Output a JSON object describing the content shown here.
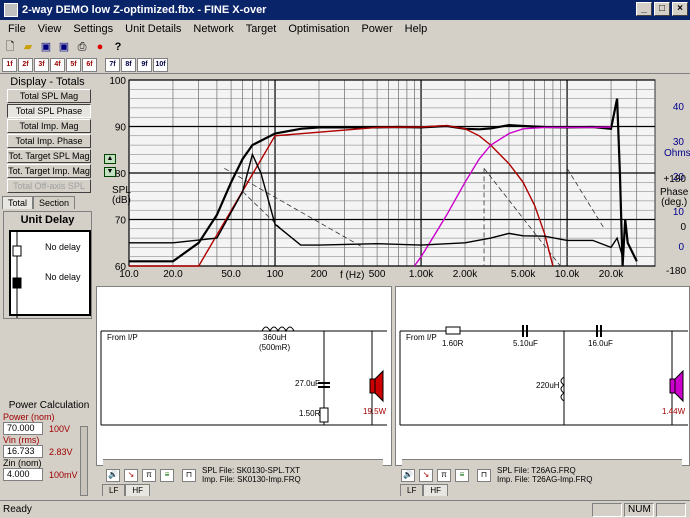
{
  "window": {
    "title": "2-way DEMO low Z-optimized.fbx - FINE X-over"
  },
  "menu": [
    "File",
    "View",
    "Settings",
    "Unit Details",
    "Network",
    "Target",
    "Optimisation",
    "Power",
    "Help"
  ],
  "toolbar2": [
    "1f",
    "2f",
    "3f",
    "4f",
    "5f",
    "6f",
    "7f",
    "8f",
    "9f",
    "10f"
  ],
  "display": {
    "title": "Display - Totals",
    "buttons": [
      "Total SPL Mag",
      "Total SPL Phase",
      "Total Imp. Mag",
      "Total Imp. Phase",
      "Tot. Target SPL Mag",
      "Tot. Target Imp. Mag",
      "Total Off-axis SPL"
    ],
    "tab_total": "Total",
    "tab_section": "Section"
  },
  "unit_delay": {
    "title": "Unit Delay",
    "delay1": "No delay",
    "delay2": "No delay"
  },
  "power": {
    "title": "Power Calculation",
    "power_label": "Power (nom)",
    "power_value": "70.000",
    "power_volt": "100V",
    "vin_label": "Vin (rms)",
    "vin_value": "16.733",
    "vin_volt": "2.83V",
    "zin_label": "Zin (nom)",
    "zin_value": "4.000",
    "zin_volt": "100mV"
  },
  "chart_data": {
    "type": "line",
    "xscale": "log",
    "xlim": [
      10,
      40000
    ],
    "ylim_left": [
      60,
      100
    ],
    "y_ticks_left": [
      "100",
      "90",
      "80",
      "70",
      "60"
    ],
    "ylabel": "SPL\n(dB)",
    "xlabel": "f (Hz)",
    "x_tick_labels": [
      "10.0",
      "20.0",
      "50.0",
      "100",
      "200",
      "500",
      "1.00k",
      "2.00k",
      "5.00k",
      "10.0k",
      "20.0k"
    ],
    "x_tick_values": [
      10,
      20,
      50,
      100,
      200,
      500,
      1000,
      2000,
      5000,
      10000,
      20000
    ],
    "right_axis": {
      "ohms_label": "Ohms",
      "ohms_ticks": [
        "40",
        "30",
        "20",
        "10",
        "0"
      ],
      "phase_label": "Phase\n(deg.)",
      "phase_ticks": [
        "+180",
        "0",
        "-180"
      ]
    },
    "series": [
      {
        "color": "#000000",
        "values_x": [
          10,
          20,
          30,
          40,
          50,
          60,
          70,
          100,
          150,
          200,
          300,
          500,
          700,
          1000,
          1500,
          2000,
          2500,
          3000,
          4000,
          5000,
          7000,
          10000,
          15000,
          20000,
          22000,
          23000,
          24000,
          25000,
          26000,
          30000
        ],
        "values_y": [
          61,
          61,
          65,
          71,
          78,
          83,
          86,
          88.5,
          89.5,
          89.8,
          89.8,
          89.8,
          89.9,
          89.8,
          90.1,
          89.5,
          89.4,
          89.6,
          90.3,
          90.1,
          89.9,
          89.8,
          89.9,
          89.5,
          96,
          80,
          60,
          70,
          65,
          61
        ]
      },
      {
        "color": "#b00000",
        "values_x": [
          10,
          30,
          100,
          500,
          1000,
          1500,
          2000,
          2500,
          3000,
          4000,
          5000,
          6000,
          7000,
          8000
        ],
        "values_y": [
          55,
          58,
          88,
          89.8,
          89.9,
          90.2,
          89.5,
          88,
          86,
          82,
          78,
          73,
          67,
          60
        ]
      },
      {
        "color": "#cc00cc",
        "values_x": [
          900,
          1000,
          1200,
          1500,
          2000,
          2500,
          3000,
          4000,
          5000,
          7000,
          10000,
          15000,
          20000
        ],
        "values_y": [
          60,
          62,
          66,
          71,
          78,
          83,
          86,
          88.5,
          89.5,
          89.8,
          89.8,
          89.8,
          89.9
        ]
      },
      {
        "color": "#000000",
        "values_x": [
          10,
          20,
          40,
          60,
          70,
          80,
          100,
          150,
          200,
          500,
          1000,
          2000,
          3000,
          4000,
          5000,
          7000,
          10000,
          15000,
          20000,
          22000,
          24000
        ],
        "values_y": [
          65,
          65,
          66,
          76,
          84,
          80,
          69,
          64.5,
          64.5,
          64.8,
          64.5,
          65,
          66,
          67,
          66.5,
          66.4,
          65.5,
          65.5,
          64,
          66,
          62
        ]
      }
    ]
  },
  "lf_schematic": {
    "input": "From I/P",
    "inductor": "360uH",
    "inductor_r": "(500mR)",
    "cap": "27.0uF",
    "res": "1.50R",
    "power": "19.5W",
    "spl_file": "SPL File:  SK0130-SPL.TXT",
    "imp_file": "Imp. File:  SK0130-Imp.FRQ"
  },
  "hf_schematic": {
    "input": "From I/P",
    "res": "1.60R",
    "cap1": "5.10uF",
    "cap2": "16.0uF",
    "inductor": "220uH",
    "power": "1.44W",
    "spl_file": "SPL File:  T26AG.FRQ",
    "imp_file": "Imp. File:  T26AG-Imp.FRQ"
  },
  "bottom_tabs": {
    "lf": "LF",
    "hf": "HF"
  },
  "status": {
    "text": "Ready",
    "num": "NUM"
  },
  "colors": {
    "title_bg": "#0a246a",
    "face": "#d4d0c8",
    "lf_speaker": "#cc0000",
    "hf_speaker": "#cc00cc",
    "power_text": "#a00000"
  }
}
